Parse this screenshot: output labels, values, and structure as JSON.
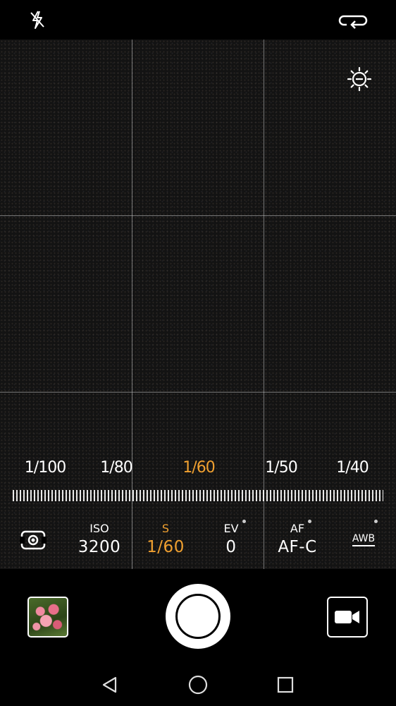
{
  "shutter_scale": {
    "values": [
      "1/100",
      "1/80",
      "1/60",
      "1/50",
      "1/40"
    ],
    "selected": "1/60"
  },
  "pro_params": [
    {
      "label": "",
      "value": "",
      "icon": "metering-icon"
    },
    {
      "label": "ISO",
      "value": "3200"
    },
    {
      "label": "S",
      "value": "1/60"
    },
    {
      "label": "EV",
      "value": "0"
    },
    {
      "label": "AF",
      "value": "AF-C"
    },
    {
      "label": "AWB",
      "value": ""
    }
  ],
  "icons": {
    "flash": "flash-off-icon",
    "switch_camera": "switch-camera-icon",
    "exposure": "exposure-icon",
    "video": "video-camera-icon",
    "nav_back": "back-icon",
    "nav_home": "home-icon",
    "nav_recents": "recents-icon"
  },
  "colors": {
    "accent": "#f0a030",
    "background": "#000000"
  }
}
